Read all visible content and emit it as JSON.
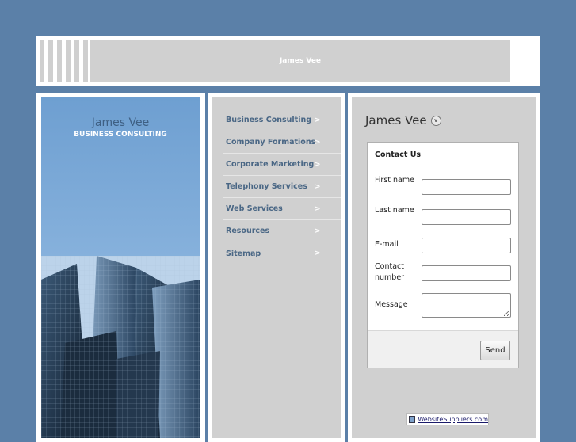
{
  "header": {
    "title": "James Vee"
  },
  "brand": {
    "title": "James Vee",
    "subtitle": "BUSINESS CONSULTING"
  },
  "nav": {
    "items": [
      {
        "label": "Business Consulting",
        "arrow": ">"
      },
      {
        "label": "Company Formations",
        "arrow": ">"
      },
      {
        "label": "Corporate Marketing",
        "arrow": ">"
      },
      {
        "label": "Telephony Services",
        "arrow": ">"
      },
      {
        "label": "Web Services",
        "arrow": ">"
      },
      {
        "label": "Resources",
        "arrow": ">"
      },
      {
        "label": "Sitemap",
        "arrow": ">"
      }
    ]
  },
  "main": {
    "heading": "James Vee",
    "heading_icon": "chevron-down-circle-icon",
    "form": {
      "title": "Contact Us",
      "fields": [
        {
          "label": "First name",
          "value": ""
        },
        {
          "label": "Last name",
          "value": ""
        },
        {
          "label": "E-mail",
          "value": ""
        },
        {
          "label": "Contact number",
          "value": ""
        },
        {
          "label": "Message",
          "value": ""
        }
      ],
      "submit_label": "Send"
    }
  },
  "footer_badge": {
    "text": "WebsiteSuppliers.com",
    "icon": "monitor-icon"
  },
  "colors": {
    "background": "#5b80a8",
    "panel": "#d0d0d0",
    "nav_text": "#4a6785"
  }
}
